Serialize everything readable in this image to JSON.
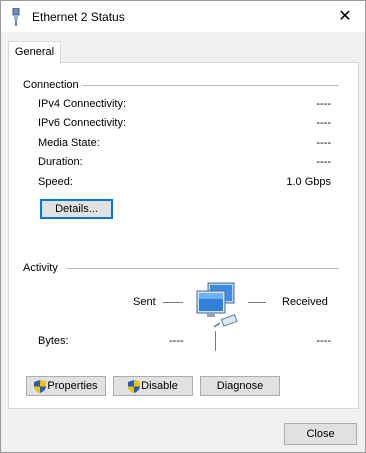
{
  "window": {
    "title": "Ethernet 2 Status",
    "close_glyph": "✕"
  },
  "tabs": [
    {
      "label": "General"
    }
  ],
  "connection": {
    "heading": "Connection",
    "rows": [
      {
        "label": "IPv4 Connectivity:",
        "value": "----"
      },
      {
        "label": "IPv6 Connectivity:",
        "value": "----"
      },
      {
        "label": "Media State:",
        "value": "----"
      },
      {
        "label": "Duration:",
        "value": "----"
      },
      {
        "label": "Speed:",
        "value": "1.0 Gbps"
      }
    ],
    "details_button": "Details..."
  },
  "activity": {
    "heading": "Activity",
    "sent_label": "Sent",
    "received_label": "Received",
    "bytes_label": "Bytes:",
    "bytes_sent": "----",
    "bytes_received": "----"
  },
  "buttons": {
    "properties": "Properties",
    "disable": "Disable",
    "diagnose": "Diagnose",
    "close": "Close"
  },
  "icons": {
    "title": "ethernet-plug-icon",
    "network": "network-computers-icon",
    "shield": "uac-shield-icon"
  },
  "colors": {
    "accent": "#0078d7",
    "window_bg": "#f0f0f0",
    "panel_bg": "#ffffff"
  }
}
